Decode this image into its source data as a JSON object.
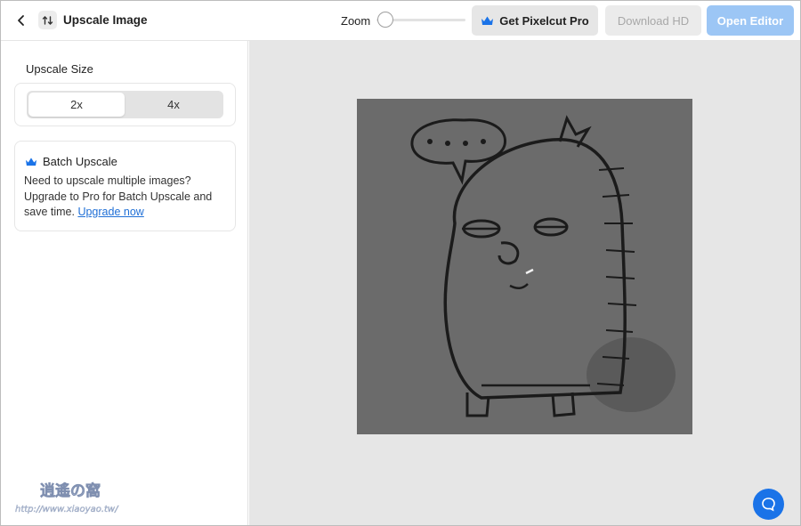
{
  "header": {
    "title": "Upscale Image",
    "zoom_label": "Zoom",
    "zoom_value": 0,
    "pro_button": "Get Pixelcut Pro",
    "download_button": "Download HD",
    "editor_button": "Open Editor"
  },
  "sidebar": {
    "size_label": "Upscale Size",
    "options": [
      "2x",
      "4x"
    ],
    "selected": "2x",
    "batch": {
      "title": "Batch Upscale",
      "text": "Need to upscale multiple images? Upgrade to Pro for Batch Upscale and save time.",
      "link": "Upgrade now"
    }
  },
  "canvas": {
    "image_description_icon": "sketch-character-image",
    "help_icon": "chat-bubble-icon"
  },
  "watermark": {
    "text": "http://www.xiaoyao.tw/"
  },
  "colors": {
    "accent": "#1a73e8",
    "link": "#1f6fd6",
    "open_editor_bg": "#9cc6f5",
    "crown": "#1a73e8"
  }
}
